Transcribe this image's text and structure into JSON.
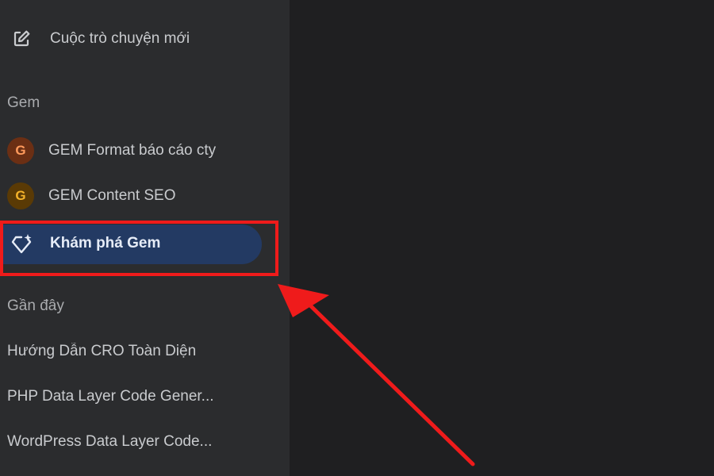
{
  "sidebar": {
    "new_chat": {
      "label": "Cuộc trò chuyện mới",
      "icon": "edit-icon"
    },
    "gem_section": {
      "title": "Gem",
      "items": [
        {
          "avatar_letter": "G",
          "label": "GEM Format báo cáo cty",
          "avatar_bg": "#6b2f14",
          "avatar_fg": "#ff9a5c"
        },
        {
          "avatar_letter": "G",
          "label": "GEM Content SEO",
          "avatar_bg": "#5a3a05",
          "avatar_fg": "#f4b22a"
        }
      ],
      "explore": {
        "label": "Khám phá Gem",
        "icon": "gem-sparkle-icon"
      }
    },
    "recent_section": {
      "title": "Gần đây",
      "items": [
        {
          "label": "Hướng Dẫn CRO Toàn Diện"
        },
        {
          "label": "PHP Data Layer Code Gener..."
        },
        {
          "label": "WordPress Data Layer Code..."
        }
      ]
    }
  },
  "colors": {
    "sidebar_bg": "#2b2c2e",
    "main_bg": "#1f1f21",
    "active_item_bg": "#233a63",
    "annotation_red": "#ef1b1b"
  }
}
